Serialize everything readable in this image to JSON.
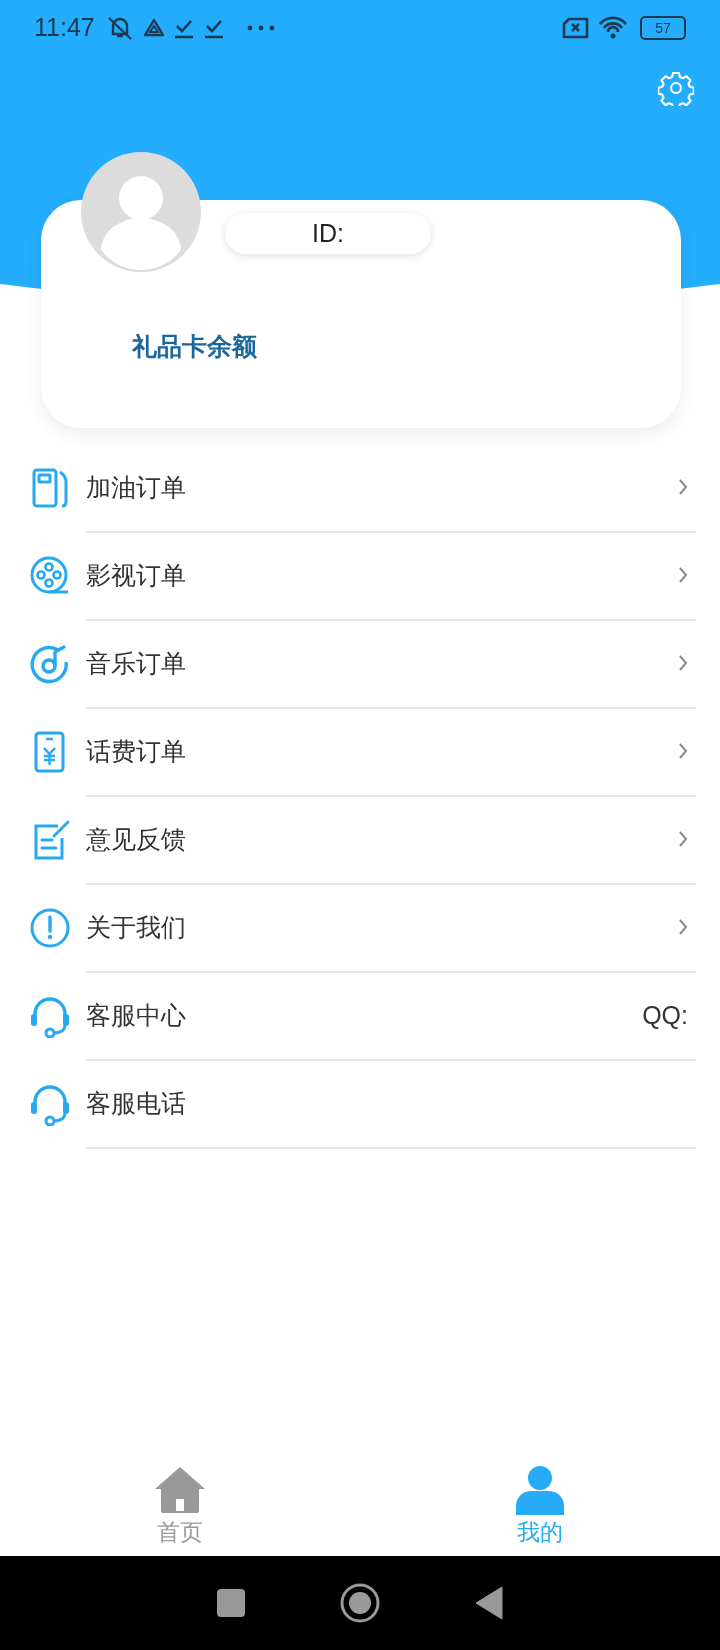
{
  "status_bar": {
    "time": "11:47",
    "battery": "57"
  },
  "profile": {
    "id_label": "ID:",
    "balance_label": "礼品卡余额"
  },
  "menu": [
    {
      "kind": "fuel",
      "label": "加油订单",
      "chevron": true
    },
    {
      "kind": "film",
      "label": "影视订单",
      "chevron": true
    },
    {
      "kind": "music",
      "label": "音乐订单",
      "chevron": true
    },
    {
      "kind": "bill",
      "label": "话费订单",
      "chevron": true
    },
    {
      "kind": "feedback",
      "label": "意见反馈",
      "chevron": true
    },
    {
      "kind": "info",
      "label": "关于我们",
      "chevron": true
    },
    {
      "kind": "support",
      "label": "客服中心",
      "chevron": false,
      "value": "QQ:"
    },
    {
      "kind": "support",
      "label": "客服电话",
      "chevron": false
    }
  ],
  "tab_bar": [
    {
      "kind": "home",
      "label": "首页",
      "selected": false
    },
    {
      "kind": "profile",
      "label": "我的",
      "selected": true
    }
  ]
}
